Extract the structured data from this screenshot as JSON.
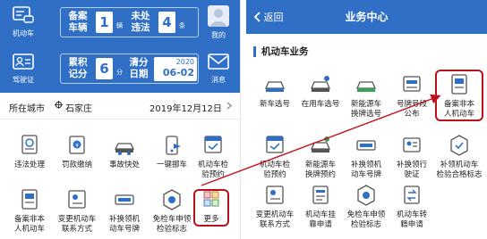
{
  "colors": {
    "brand": "#2f6fc6",
    "highlight": "#b5121b",
    "arrow": "#c0121b"
  },
  "left": {
    "header": {
      "nav_left_top": {
        "label": "机动车",
        "icon": "car-dashboard-icon"
      },
      "nav_left_bottom": {
        "label": "驾驶证",
        "icon": "license-card-icon"
      },
      "nav_right_top": {
        "label": "我的",
        "icon": "avatar-icon"
      },
      "nav_right_bottom": {
        "label": "消息",
        "icon": "envelope-icon"
      },
      "card1": {
        "lbl_a": "备案\n车辆",
        "num_a": "1",
        "unit_a": "辆",
        "lbl_b": "未处\n违法",
        "num_b": "4",
        "unit_b": "条"
      },
      "card2": {
        "lbl_a": "累积\n记分",
        "num_a": "6",
        "unit_a": "分",
        "lbl_b": "清分\n日期",
        "year": "2020",
        "date": "06-02"
      }
    },
    "city": {
      "label": "所在城市",
      "name": "石家庄",
      "date": "2019年12月12日"
    },
    "grid": [
      {
        "label": "违法处理",
        "icon": "violation-icon"
      },
      {
        "label": "罚款缴纳",
        "icon": "fine-payment-icon"
      },
      {
        "label": "事故快处",
        "icon": "accident-icon"
      },
      {
        "label": "一键挪车",
        "icon": "move-car-icon"
      },
      {
        "label": "机动车检\n验预约",
        "icon": "inspection-booking-icon"
      },
      {
        "label": "备案非本\n人机动车",
        "icon": "register-vehicle-icon"
      },
      {
        "label": "变更机动车\n联系方式",
        "icon": "change-contact-icon"
      },
      {
        "label": "补换领机\n动车号牌",
        "icon": "replace-plate-icon"
      },
      {
        "label": "免检车申领\n检验标志",
        "icon": "exempt-sticker-icon"
      },
      {
        "label": "更多",
        "icon": "more-grid-icon"
      }
    ]
  },
  "right": {
    "header": {
      "back_label": "返回",
      "title": "业务中心"
    },
    "section_title": "机动车业务",
    "grid": [
      {
        "label": "新车选号",
        "icon": "new-car-number-icon"
      },
      {
        "label": "在用车选号",
        "icon": "used-car-number-icon"
      },
      {
        "label": "新能源车\n换牌选号",
        "icon": "ev-plate-icon"
      },
      {
        "label": "号牌号段\n公布",
        "icon": "plate-range-icon"
      },
      {
        "label": "备案非本\n人机动车",
        "icon": "register-vehicle-icon"
      },
      {
        "label": "机动车检\n验预约",
        "icon": "inspection-booking-icon"
      },
      {
        "label": "新能源车\n换牌预约",
        "icon": "ev-booking-icon"
      },
      {
        "label": "补换领机\n动车号牌",
        "icon": "replace-plate-icon"
      },
      {
        "label": "补换领行\n驶证",
        "icon": "replace-license-icon"
      },
      {
        "label": "补领机动车\n检验合格标志",
        "icon": "inspection-sticker-icon"
      },
      {
        "label": "变更机动车\n联系方式",
        "icon": "change-contact-icon"
      },
      {
        "label": "机动车挂\n靠申请",
        "icon": "affiliation-icon"
      },
      {
        "label": "免检车申领\n检验标志",
        "icon": "exempt-sticker-icon"
      },
      {
        "label": "机动车转\n籍申请",
        "icon": "transfer-icon"
      }
    ]
  }
}
